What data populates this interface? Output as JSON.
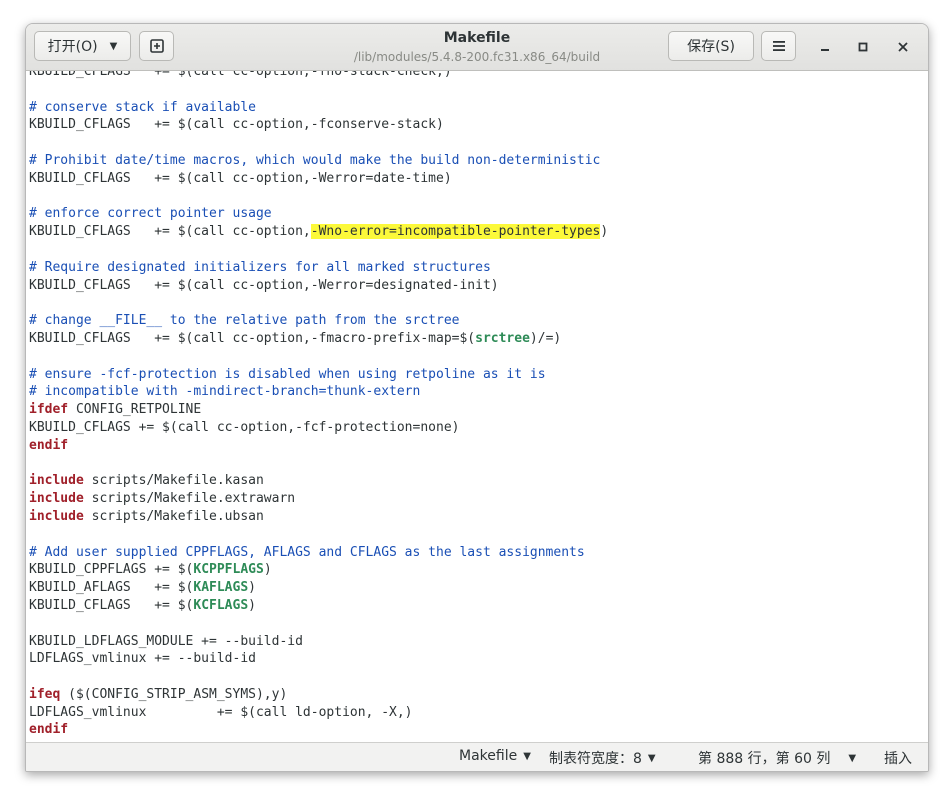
{
  "window": {
    "title": "Makefile",
    "subtitle": "/lib/modules/5.4.8-200.fc31.x86_64/build"
  },
  "toolbar": {
    "open_label": "打开(O)",
    "save_label": "保存(S)"
  },
  "editor": {
    "lines": [
      [
        {
          "t": "KBUILD_CFLAGS   += $(call cc-option,-fno-stack-check,)"
        }
      ],
      [],
      [
        {
          "t": "# conserve stack if available",
          "c": "cmt"
        }
      ],
      [
        {
          "t": "KBUILD_CFLAGS   += $(call cc-option,-fconserve-stack)"
        }
      ],
      [],
      [
        {
          "t": "# Prohibit date/time macros, which would make the build non-deterministic",
          "c": "cmt"
        }
      ],
      [
        {
          "t": "KBUILD_CFLAGS   += $(call cc-option,-Werror=date-time)"
        }
      ],
      [],
      [
        {
          "t": "# enforce correct pointer usage",
          "c": "cmt"
        }
      ],
      [
        {
          "t": "KBUILD_CFLAGS   += $(call cc-option,"
        },
        {
          "t": "-Wno-error=incompatible-pointer-types",
          "c": "hl"
        },
        {
          "t": ")"
        }
      ],
      [],
      [
        {
          "t": "# Require designated initializers for all marked structures",
          "c": "cmt"
        }
      ],
      [
        {
          "t": "KBUILD_CFLAGS   += $(call cc-option,-Werror=designated-init)"
        }
      ],
      [],
      [
        {
          "t": "# change __FILE__ to the relative path from the srctree",
          "c": "cmt"
        }
      ],
      [
        {
          "t": "KBUILD_CFLAGS   += $(call cc-option,-fmacro-prefix-map=$("
        },
        {
          "t": "srctree",
          "c": "var"
        },
        {
          "t": ")/=)"
        }
      ],
      [],
      [
        {
          "t": "# ensure -fcf-protection is disabled when using retpoline as it is",
          "c": "cmt"
        }
      ],
      [
        {
          "t": "# incompatible with -mindirect-branch=thunk-extern",
          "c": "cmt"
        }
      ],
      [
        {
          "t": "ifdef",
          "c": "kw"
        },
        {
          "t": " CONFIG_RETPOLINE"
        }
      ],
      [
        {
          "t": "KBUILD_CFLAGS += $(call cc-option,-fcf-protection=none)"
        }
      ],
      [
        {
          "t": "endif",
          "c": "kw"
        }
      ],
      [],
      [
        {
          "t": "include",
          "c": "kw"
        },
        {
          "t": " scripts/Makefile.kasan"
        }
      ],
      [
        {
          "t": "include",
          "c": "kw"
        },
        {
          "t": " scripts/Makefile.extrawarn"
        }
      ],
      [
        {
          "t": "include",
          "c": "kw"
        },
        {
          "t": " scripts/Makefile.ubsan"
        }
      ],
      [],
      [
        {
          "t": "# Add user supplied CPPFLAGS, AFLAGS and CFLAGS as the last assignments",
          "c": "cmt"
        }
      ],
      [
        {
          "t": "KBUILD_CPPFLAGS += $("
        },
        {
          "t": "KCPPFLAGS",
          "c": "var"
        },
        {
          "t": ")"
        }
      ],
      [
        {
          "t": "KBUILD_AFLAGS   += $("
        },
        {
          "t": "KAFLAGS",
          "c": "var"
        },
        {
          "t": ")"
        }
      ],
      [
        {
          "t": "KBUILD_CFLAGS   += $("
        },
        {
          "t": "KCFLAGS",
          "c": "var"
        },
        {
          "t": ")"
        }
      ],
      [],
      [
        {
          "t": "KBUILD_LDFLAGS_MODULE += --build-id"
        }
      ],
      [
        {
          "t": "LDFLAGS_vmlinux += --build-id"
        }
      ],
      [],
      [
        {
          "t": "ifeq",
          "c": "kw"
        },
        {
          "t": " ($(CONFIG_STRIP_ASM_SYMS),y)"
        }
      ],
      [
        {
          "t": "LDFLAGS_vmlinux         += $(call ld-option, -X,)"
        }
      ],
      [
        {
          "t": "endif",
          "c": "kw"
        }
      ],
      []
    ]
  },
  "statusbar": {
    "language": "Makefile",
    "tab_width": "制表符宽度：8",
    "position": "第 888 行，第 60 列",
    "mode": "插入"
  },
  "colors": {
    "comment": "#1a4fb5",
    "keyword": "#a0202a",
    "variable": "#2e8b57",
    "highlight": "#fcf93a"
  },
  "icons": {
    "open_dropdown": "chevron-down-icon",
    "new_tab": "new-tab-icon",
    "menu": "hamburger-menu-icon",
    "minimize": "minimize-icon",
    "maximize": "maximize-icon",
    "close": "close-icon"
  }
}
